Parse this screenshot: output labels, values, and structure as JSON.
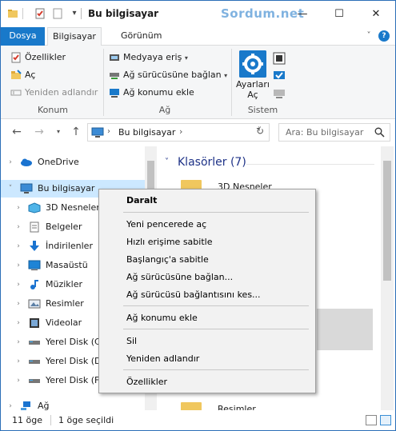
{
  "window": {
    "title": "Bu bilgisayar",
    "watermark": "Sordum.net"
  },
  "ribbon_tabs": {
    "file": "Dosya",
    "computer": "Bilgisayar",
    "view": "Görünüm"
  },
  "ribbon": {
    "konum": {
      "properties": "Özellikler",
      "open": "Aç",
      "rename": "Yeniden adlandır",
      "label": "Konum"
    },
    "ag": {
      "media": "Medyaya eriş",
      "map_drive": "Ağ sürücüsüne bağlan",
      "add_location": "Ağ konumu ekle",
      "label": "Ağ"
    },
    "sistem": {
      "settings_line1": "Ayarları",
      "settings_line2": "Aç",
      "label": "Sistem"
    }
  },
  "address_bar": {
    "path": "Bu bilgisayar",
    "search_placeholder": "Ara: Bu bilgisayar"
  },
  "nav_tree": {
    "items": [
      {
        "label": "OneDrive",
        "icon": "cloud-icon"
      },
      {
        "label": "Bu bilgisayar",
        "icon": "computer-icon"
      },
      {
        "label": "3D Nesneler",
        "icon": "3d-objects-icon"
      },
      {
        "label": "Belgeler",
        "icon": "documents-icon"
      },
      {
        "label": "İndirilenler",
        "icon": "downloads-icon"
      },
      {
        "label": "Masaüstü",
        "icon": "desktop-icon"
      },
      {
        "label": "Müzikler",
        "icon": "music-icon"
      },
      {
        "label": "Resimler",
        "icon": "pictures-icon"
      },
      {
        "label": "Videolar",
        "icon": "videos-icon"
      },
      {
        "label": "Yerel Disk (C:",
        "icon": "drive-icon"
      },
      {
        "label": "Yerel Disk (D:",
        "icon": "drive-icon"
      },
      {
        "label": "Yerel Disk (F:",
        "icon": "drive-icon"
      },
      {
        "label": "Ağ",
        "icon": "network-icon"
      }
    ]
  },
  "content": {
    "group_header": "Klasörler (7)",
    "folders": [
      {
        "label": "3D Nesneler"
      },
      {
        "label": "Resimler"
      }
    ]
  },
  "context_menu": {
    "collapse": "Daralt",
    "open_new_window": "Yeni pencerede aç",
    "pin_quick_access": "Hızlı erişime sabitle",
    "pin_start": "Başlangıç'a sabitle",
    "map_drive": "Ağ sürücüsüne bağlan...",
    "disconnect_drive": "Ağ sürücüsü bağlantısını kes...",
    "add_network_location": "Ağ konumu ekle",
    "delete": "Sil",
    "rename": "Yeniden adlandır",
    "properties": "Özellikler"
  },
  "status_bar": {
    "item_count": "11 öge",
    "selected": "1 öge seçildi"
  },
  "colors": {
    "accent": "#1979ca",
    "selection": "#cce8ff",
    "header_text": "#1e3287"
  }
}
